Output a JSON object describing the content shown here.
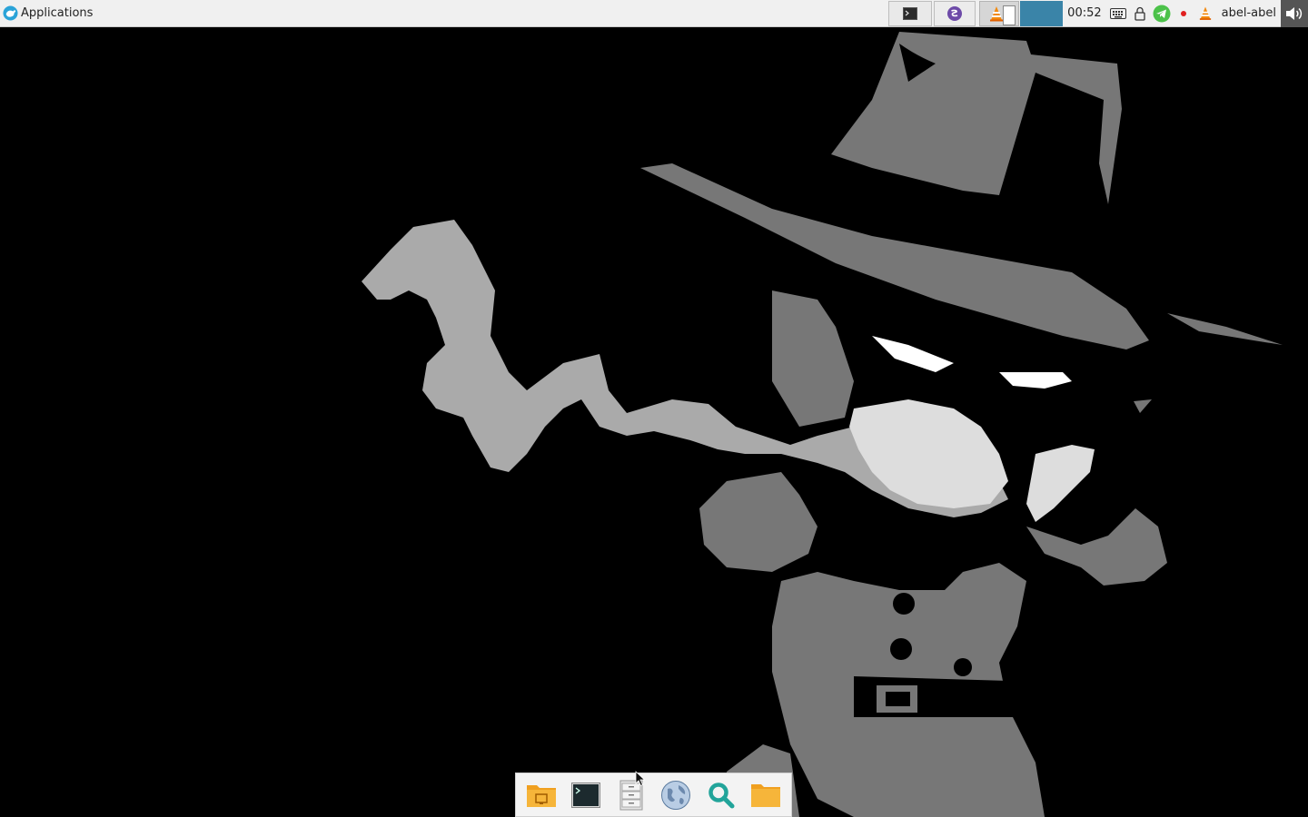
{
  "panel": {
    "applications_label": "Applications",
    "clock": "00:52",
    "username": "abel-abel",
    "windows": [
      {
        "name": "terminal",
        "icon": "terminal-icon"
      },
      {
        "name": "emacs",
        "icon": "emacs-icon"
      },
      {
        "name": "vlc",
        "icon": "vlc-icon"
      }
    ],
    "tray": [
      "keyboard-icon",
      "lock-icon",
      "telegram-icon",
      "record-icon",
      "vlc-icon"
    ],
    "active_workspace_color": "#3a84a8"
  },
  "dock": {
    "items": [
      {
        "name": "desktop-folder",
        "icon": "desktop-folder-icon"
      },
      {
        "name": "terminal",
        "icon": "terminal-icon"
      },
      {
        "name": "file-cabinet",
        "icon": "file-cabinet-icon"
      },
      {
        "name": "web-browser",
        "icon": "globe-icon"
      },
      {
        "name": "app-finder",
        "icon": "search-icon"
      },
      {
        "name": "home-folder",
        "icon": "folder-icon"
      }
    ]
  },
  "colors": {
    "panel_bg": "#f0f0f0",
    "wallpaper_bg": "#000000",
    "smoke": "#aaaaaa",
    "figure": "#777777"
  }
}
